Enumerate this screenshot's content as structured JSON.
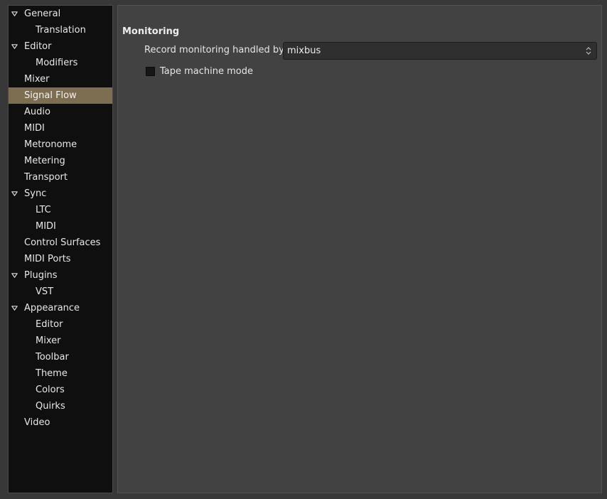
{
  "sidebar": {
    "items": [
      {
        "label": "General",
        "expanded": true,
        "level": 0
      },
      {
        "label": "Translation",
        "level": 1
      },
      {
        "label": "Editor",
        "expanded": true,
        "level": 0
      },
      {
        "label": "Modifiers",
        "level": 1
      },
      {
        "label": "Mixer",
        "level": 0
      },
      {
        "label": "Signal Flow",
        "level": 0,
        "selected": true
      },
      {
        "label": "Audio",
        "level": 0
      },
      {
        "label": "MIDI",
        "level": 0
      },
      {
        "label": "Metronome",
        "level": 0
      },
      {
        "label": "Metering",
        "level": 0
      },
      {
        "label": "Transport",
        "level": 0
      },
      {
        "label": "Sync",
        "expanded": true,
        "level": 0
      },
      {
        "label": "LTC",
        "level": 1
      },
      {
        "label": "MIDI",
        "level": 1
      },
      {
        "label": "Control Surfaces",
        "level": 0
      },
      {
        "label": "MIDI Ports",
        "level": 0
      },
      {
        "label": "Plugins",
        "expanded": true,
        "level": 0
      },
      {
        "label": "VST",
        "level": 1
      },
      {
        "label": "Appearance",
        "expanded": true,
        "level": 0
      },
      {
        "label": "Editor",
        "level": 1
      },
      {
        "label": "Mixer",
        "level": 1
      },
      {
        "label": "Toolbar",
        "level": 1
      },
      {
        "label": "Theme",
        "level": 1
      },
      {
        "label": "Colors",
        "level": 1
      },
      {
        "label": "Quirks",
        "level": 1
      },
      {
        "label": "Video",
        "level": 0
      }
    ]
  },
  "content": {
    "section_title": "Monitoring",
    "record_monitoring": {
      "label": "Record monitoring handled by:",
      "value": "mixbus"
    },
    "tape_machine": {
      "label": "Tape machine mode",
      "checked": false
    }
  },
  "colors": {
    "selected_bg": "#7d6e52",
    "sidebar_bg": "#0f0f0f",
    "content_bg": "#434242"
  },
  "icons": {
    "expander": "triangle-down-icon",
    "select": "chevron-updown-icon"
  }
}
